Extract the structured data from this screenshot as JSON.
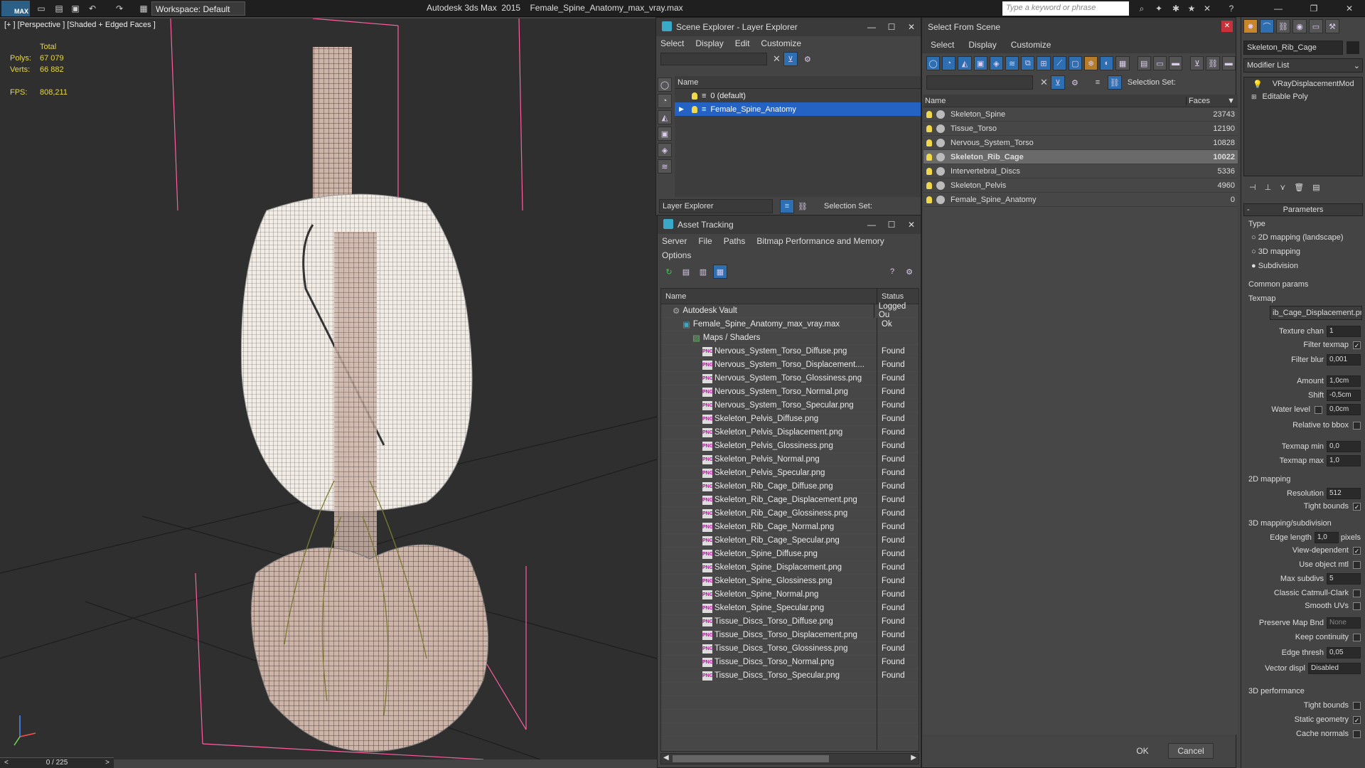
{
  "titlebar": {
    "logo": "MAX",
    "workspace_label": "Workspace: Default",
    "app_title": "Autodesk 3ds Max  2015",
    "file_title": "Female_Spine_Anatomy_max_vray.max",
    "search_placeholder": "Type a keyword or phrase"
  },
  "viewport": {
    "label": "[+ ] [Perspective ] [Shaded + Edged Faces ]",
    "stats": {
      "total_label": "Total",
      "polys_label": "Polys:",
      "polys_value": "67 079",
      "verts_label": "Verts:",
      "verts_value": "66 882",
      "fps_label": "FPS:",
      "fps_value": "808,211"
    },
    "timeline": "0 / 225"
  },
  "scene_explorer": {
    "title": "Scene Explorer - Layer Explorer",
    "menu": [
      "Select",
      "Display",
      "Edit",
      "Customize"
    ],
    "column_name": "Name",
    "layers": [
      "0 (default)",
      "Female_Spine_Anatomy"
    ],
    "footer_dropdown": "Layer Explorer",
    "selection_set_label": "Selection Set:"
  },
  "asset_tracking": {
    "title": "Asset Tracking",
    "menu": [
      "Server",
      "File",
      "Paths",
      "Bitmap Performance and Memory"
    ],
    "menu2": [
      "Options"
    ],
    "col_name": "Name",
    "col_status": "Status",
    "rows": [
      {
        "name": "Autodesk Vault",
        "status": "Logged Ou",
        "indent": 1
      },
      {
        "name": "Female_Spine_Anatomy_max_vray.max",
        "status": "Ok",
        "indent": 2
      },
      {
        "name": "Maps / Shaders",
        "status": "",
        "indent": 3
      },
      {
        "name": "Nervous_System_Torso_Diffuse.png",
        "status": "Found",
        "indent": 4
      },
      {
        "name": "Nervous_System_Torso_Displacement....",
        "status": "Found",
        "indent": 4
      },
      {
        "name": "Nervous_System_Torso_Glossiness.png",
        "status": "Found",
        "indent": 4
      },
      {
        "name": "Nervous_System_Torso_Normal.png",
        "status": "Found",
        "indent": 4
      },
      {
        "name": "Nervous_System_Torso_Specular.png",
        "status": "Found",
        "indent": 4
      },
      {
        "name": "Skeleton_Pelvis_Diffuse.png",
        "status": "Found",
        "indent": 4
      },
      {
        "name": "Skeleton_Pelvis_Displacement.png",
        "status": "Found",
        "indent": 4
      },
      {
        "name": "Skeleton_Pelvis_Glossiness.png",
        "status": "Found",
        "indent": 4
      },
      {
        "name": "Skeleton_Pelvis_Normal.png",
        "status": "Found",
        "indent": 4
      },
      {
        "name": "Skeleton_Pelvis_Specular.png",
        "status": "Found",
        "indent": 4
      },
      {
        "name": "Skeleton_Rib_Cage_Diffuse.png",
        "status": "Found",
        "indent": 4
      },
      {
        "name": "Skeleton_Rib_Cage_Displacement.png",
        "status": "Found",
        "indent": 4
      },
      {
        "name": "Skeleton_Rib_Cage_Glossiness.png",
        "status": "Found",
        "indent": 4
      },
      {
        "name": "Skeleton_Rib_Cage_Normal.png",
        "status": "Found",
        "indent": 4
      },
      {
        "name": "Skeleton_Rib_Cage_Specular.png",
        "status": "Found",
        "indent": 4
      },
      {
        "name": "Skeleton_Spine_Diffuse.png",
        "status": "Found",
        "indent": 4
      },
      {
        "name": "Skeleton_Spine_Displacement.png",
        "status": "Found",
        "indent": 4
      },
      {
        "name": "Skeleton_Spine_Glossiness.png",
        "status": "Found",
        "indent": 4
      },
      {
        "name": "Skeleton_Spine_Normal.png",
        "status": "Found",
        "indent": 4
      },
      {
        "name": "Skeleton_Spine_Specular.png",
        "status": "Found",
        "indent": 4
      },
      {
        "name": "Tissue_Discs_Torso_Diffuse.png",
        "status": "Found",
        "indent": 4
      },
      {
        "name": "Tissue_Discs_Torso_Displacement.png",
        "status": "Found",
        "indent": 4
      },
      {
        "name": "Tissue_Discs_Torso_Glossiness.png",
        "status": "Found",
        "indent": 4
      },
      {
        "name": "Tissue_Discs_Torso_Normal.png",
        "status": "Found",
        "indent": 4
      },
      {
        "name": "Tissue_Discs_Torso_Specular.png",
        "status": "Found",
        "indent": 4
      }
    ]
  },
  "select_from_scene": {
    "title": "Select From Scene",
    "menu": [
      "Select",
      "Display",
      "Customize"
    ],
    "selection_set_label": "Selection Set:",
    "col_name": "Name",
    "col_faces": "Faces",
    "rows": [
      {
        "name": "Skeleton_Spine",
        "faces": "23743",
        "selected": false
      },
      {
        "name": "Tissue_Torso",
        "faces": "12190",
        "selected": false
      },
      {
        "name": "Nervous_System_Torso",
        "faces": "10828",
        "selected": false
      },
      {
        "name": "Skeleton_Rib_Cage",
        "faces": "10022",
        "selected": true
      },
      {
        "name": "Intervertebral_Discs",
        "faces": "5336",
        "selected": false
      },
      {
        "name": "Skeleton_Pelvis",
        "faces": "4960",
        "selected": false
      },
      {
        "name": "Female_Spine_Anatomy",
        "faces": "0",
        "selected": false
      }
    ],
    "ok_label": "OK",
    "cancel_label": "Cancel"
  },
  "command_panel": {
    "object_name": "Skeleton_Rib_Cage",
    "modifier_list": "Modifier List",
    "stack": [
      "VRayDisplacementMod",
      "Editable Poly"
    ],
    "rollout_title": "Parameters",
    "type_label": "Type",
    "type_options": [
      "2D mapping (landscape)",
      "3D mapping",
      "Subdivision"
    ],
    "type_selected": 2,
    "common_params": "Common params",
    "texmap_label": "Texmap",
    "texmap_value": "ib_Cage_Displacement.png)",
    "texture_chan_label": "Texture chan",
    "texture_chan_value": "1",
    "filter_texmap_label": "Filter texmap",
    "filter_blur_label": "Filter blur",
    "filter_blur_value": "0,001",
    "amount_label": "Amount",
    "amount_value": "1,0cm",
    "shift_label": "Shift",
    "shift_value": "-0,5cm",
    "water_level_label": "Water level",
    "water_level_value": "0,0cm",
    "relative_bbox_label": "Relative to bbox",
    "texmap_min_label": "Texmap min",
    "texmap_min_value": "0,0",
    "texmap_max_label": "Texmap max",
    "texmap_max_value": "1,0",
    "mapping2d_label": "2D mapping",
    "resolution_label": "Resolution",
    "resolution_value": "512",
    "tight_bounds_label": "Tight bounds",
    "mapping3d_label": "3D mapping/subdivision",
    "edge_length_label": "Edge length",
    "edge_length_value": "1,0",
    "pixels_label": "pixels",
    "view_dependent_label": "View-dependent",
    "use_object_mtl_label": "Use object mtl",
    "max_subdivs_label": "Max subdivs",
    "max_subdivs_value": "5",
    "classic_cc_label": "Classic Catmull-Clark",
    "smooth_uvs_label": "Smooth UVs",
    "preserve_map_label": "Preserve Map Bnd",
    "preserve_map_value": "None",
    "keep_continuity_label": "Keep continuity",
    "edge_thresh_label": "Edge thresh",
    "edge_thresh_value": "0,05",
    "vector_displ_label": "Vector displ",
    "vector_displ_value": "Disabled",
    "perf3d_label": "3D performance",
    "tight_bounds2_label": "Tight bounds",
    "static_geometry_label": "Static geometry",
    "cache_normals_label": "Cache normals"
  }
}
